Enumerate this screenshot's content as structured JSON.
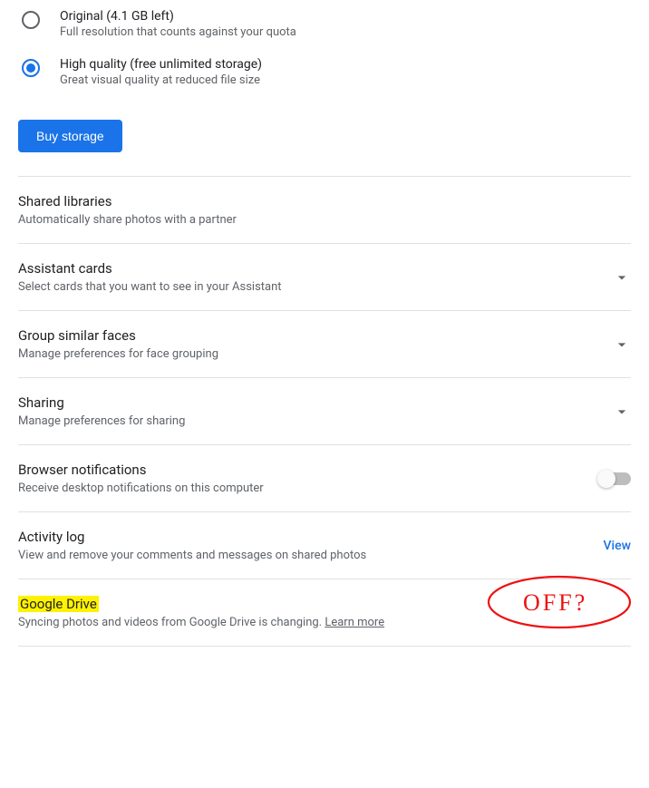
{
  "upload": {
    "original": {
      "title": "Original (4.1 GB left)",
      "sub": "Full resolution that counts against your quota",
      "selected": false
    },
    "high_quality": {
      "title": "High quality (free unlimited storage)",
      "sub": "Great visual quality at reduced file size",
      "selected": true
    },
    "buy_label": "Buy storage"
  },
  "sections": {
    "shared_libraries": {
      "title": "Shared libraries",
      "sub": "Automatically share photos with a partner"
    },
    "assistant_cards": {
      "title": "Assistant cards",
      "sub": "Select cards that you want to see in your Assistant"
    },
    "group_faces": {
      "title": "Group similar faces",
      "sub": "Manage preferences for face grouping"
    },
    "sharing": {
      "title": "Sharing",
      "sub": "Manage preferences for sharing"
    },
    "browser_notifications": {
      "title": "Browser notifications",
      "sub": "Receive desktop notifications on this computer",
      "toggle": false
    },
    "activity_log": {
      "title": "Activity log",
      "sub": "View and remove your comments and messages on shared photos",
      "view_label": "View"
    },
    "google_drive": {
      "title": "Google Drive",
      "sub_prefix": "Syncing photos and videos from Google Drive is changing. ",
      "learn_more": "Learn more"
    }
  },
  "annotation": {
    "text": "OFF?"
  }
}
